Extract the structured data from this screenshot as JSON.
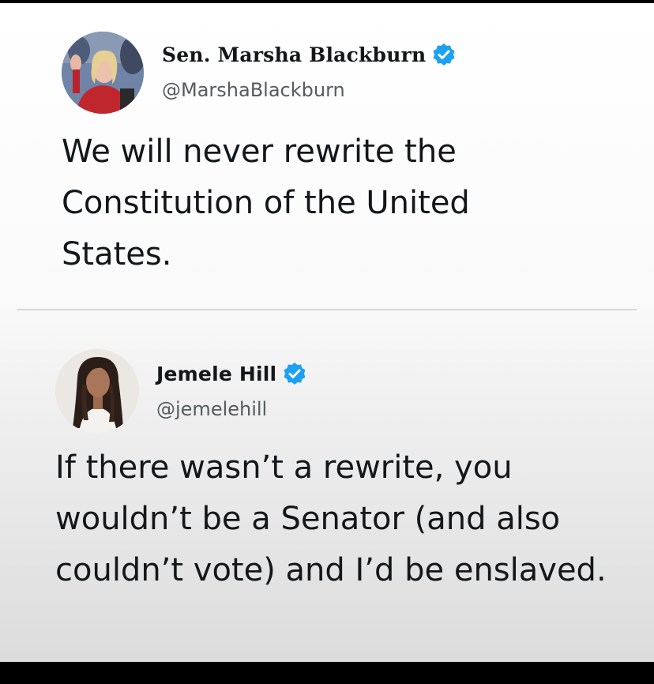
{
  "tweets": [
    {
      "display_name": "Sen. Marsha Blackburn",
      "handle": "@MarshaBlackburn",
      "verified": true,
      "text": "We will never rewrite the Constitution of the United States."
    },
    {
      "display_name": "Jemele Hill",
      "handle": "@jemelehill",
      "verified": true,
      "text": "If there wasn’t a rewrite, you wouldn’t be a Senator (and also couldn’t vote) and I’d be enslaved."
    }
  ],
  "colors": {
    "verified_blue": "#1da1f2",
    "text_primary": "#14171a",
    "text_secondary": "#555b61",
    "divider": "#d6d6d6"
  },
  "icons": {
    "verified": "verified-badge-icon"
  }
}
